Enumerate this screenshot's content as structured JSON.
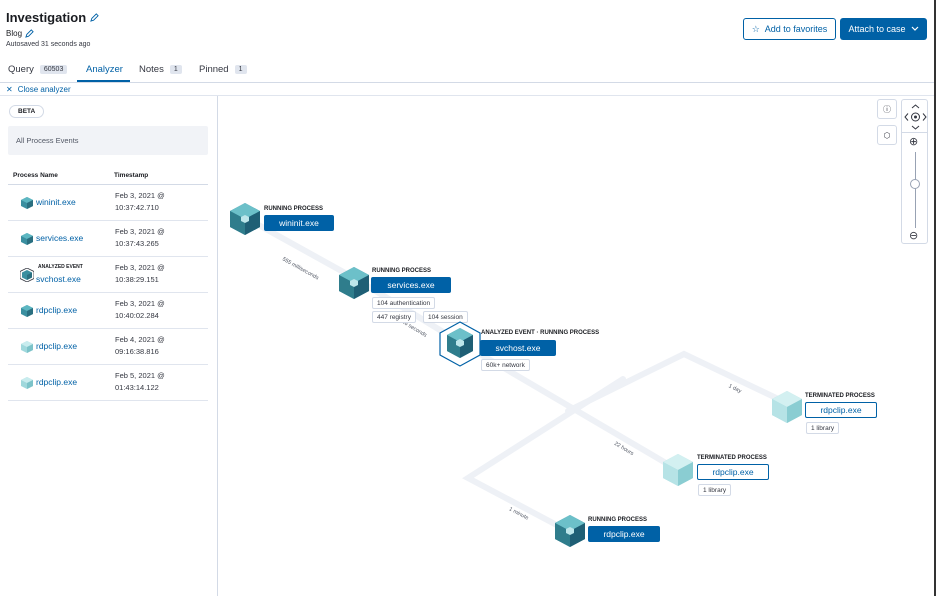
{
  "header": {
    "title": "Investigation",
    "subtitle": "Blog",
    "autosave": "Autosaved 31 seconds ago",
    "favorites_label": "Add to favorites",
    "attach_label": "Attach to case"
  },
  "tabs": [
    {
      "label": "Query",
      "count": "60503"
    },
    {
      "label": "Analyzer",
      "count": ""
    },
    {
      "label": "Notes",
      "count": "1"
    },
    {
      "label": "Pinned",
      "count": "1"
    }
  ],
  "close_analyzer": "Close analyzer",
  "panel": {
    "beta": "BETA",
    "breadcrumb": "All Process Events",
    "col_name": "Process Name",
    "col_time": "Timestamp",
    "rows": [
      {
        "name": "wininit.exe",
        "tag": "",
        "date": "Feb 3, 2021 @",
        "time": "10:37:42.710"
      },
      {
        "name": "services.exe",
        "tag": "",
        "date": "Feb 3, 2021 @",
        "time": "10:37:43.265"
      },
      {
        "name": "svchost.exe",
        "tag": "ANALYZED EVENT",
        "date": "Feb 3, 2021 @",
        "time": "10:38:29.151"
      },
      {
        "name": "rdpclip.exe",
        "tag": "",
        "date": "Feb 3, 2021 @",
        "time": "10:40:02.284"
      },
      {
        "name": "rdpclip.exe",
        "tag": "",
        "date": "Feb 4, 2021 @",
        "time": "09:16:38.816"
      },
      {
        "name": "rdpclip.exe",
        "tag": "",
        "date": "Feb 5, 2021 @",
        "time": "01:43:14.122"
      }
    ]
  },
  "graph": {
    "nodes": [
      {
        "state": "RUNNING PROCESS",
        "name": "wininit.exe",
        "pills": []
      },
      {
        "state": "RUNNING PROCESS",
        "name": "services.exe",
        "pills": [
          "104 authentication",
          "447 registry",
          "104 session"
        ]
      },
      {
        "state": "ANALYZED EVENT · RUNNING PROCESS",
        "name": "svchost.exe",
        "pills": [
          "60k+ network"
        ]
      },
      {
        "state": "TERMINATED PROCESS",
        "name": "rdpclip.exe",
        "pills": [
          "1 library"
        ]
      },
      {
        "state": "TERMINATED PROCESS",
        "name": "rdpclip.exe",
        "pills": [
          "1 library"
        ]
      },
      {
        "state": "RUNNING PROCESS",
        "name": "rdpclip.exe",
        "pills": []
      }
    ],
    "edges": [
      "555 milliseconds",
      "46 seconds",
      "1 day",
      "22 hours",
      "1 minute"
    ]
  },
  "controls": {
    "info_glyph": "ⓘ",
    "schema_glyph": "⬡",
    "zoom_in": "⊕",
    "zoom_out": "⊖"
  },
  "colors": {
    "accent": "#0061a6",
    "cube_dark": "#2f7d8c",
    "cube_light": "#8fd4d9"
  }
}
